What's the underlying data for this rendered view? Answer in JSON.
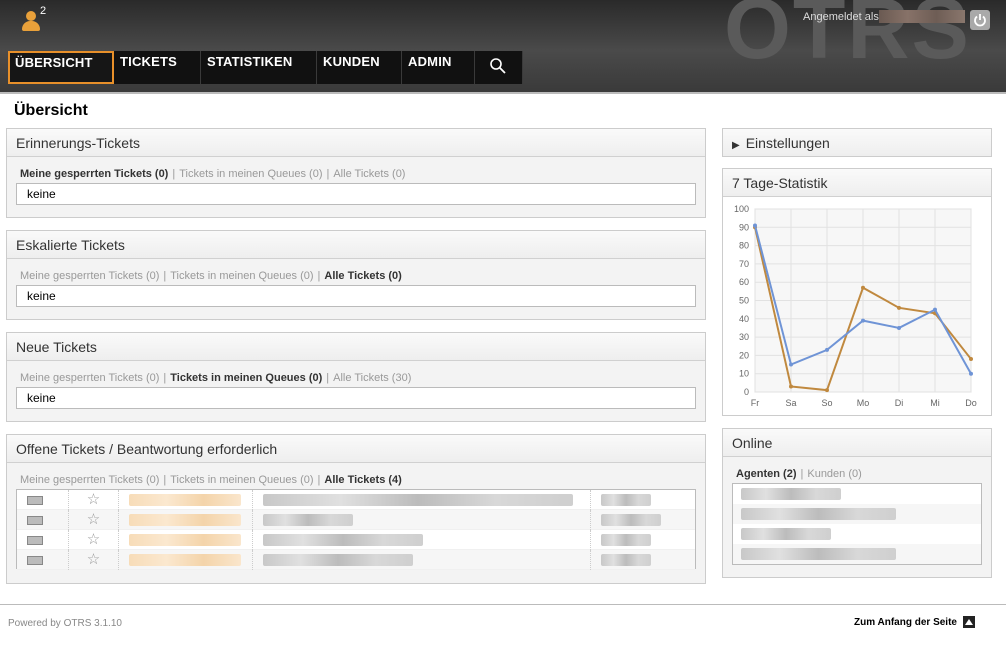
{
  "header": {
    "logo_text": "OTRS",
    "avatar_count": "2",
    "login_label": "Angemeldet als"
  },
  "nav": {
    "items": [
      {
        "label": "ÜBERSICHT",
        "active": true
      },
      {
        "label": "TICKETS",
        "active": false
      },
      {
        "label": "STATISTIKEN",
        "active": false
      },
      {
        "label": "KUNDEN",
        "active": false
      },
      {
        "label": "ADMIN",
        "active": false
      }
    ],
    "search_icon": "magnifier-icon"
  },
  "page": {
    "title": "Übersicht"
  },
  "widgets": {
    "reminder": {
      "title": "Erinnerungs-Tickets",
      "tabs": [
        "Meine gesperrten Tickets (0)",
        "Tickets in meinen Queues (0)",
        "Alle Tickets (0)"
      ],
      "selected": 0,
      "empty": "keine"
    },
    "escalated": {
      "title": "Eskalierte Tickets",
      "tabs": [
        "Meine gesperrten Tickets (0)",
        "Tickets in meinen Queues (0)",
        "Alle Tickets (0)"
      ],
      "selected": 2,
      "empty": "keine"
    },
    "new": {
      "title": "Neue Tickets",
      "tabs": [
        "Meine gesperrten Tickets (0)",
        "Tickets in meinen Queues (0)",
        "Alle Tickets (30)"
      ],
      "selected": 1,
      "empty": "keine"
    },
    "open": {
      "title": "Offene Tickets / Beantwortung erforderlich",
      "tabs": [
        "Meine gesperrten Tickets (0)",
        "Tickets in meinen Queues (0)",
        "Alle Tickets (4)"
      ],
      "selected": 2,
      "row_count": 4
    },
    "settings": {
      "title": "Einstellungen"
    },
    "stats": {
      "title": "7 Tage-Statistik"
    },
    "online": {
      "title": "Online",
      "tabs": [
        "Agenten (2)",
        "Kunden (0)"
      ],
      "selected": 0
    }
  },
  "colors": {
    "accent_orange": "#e8902a",
    "series_blue": "#6f94d6",
    "series_orange": "#c0893f"
  },
  "chart_data": {
    "type": "line",
    "categories": [
      "Fr",
      "Sa",
      "So",
      "Mo",
      "Di",
      "Mi",
      "Do"
    ],
    "series": [
      {
        "values": [
          90,
          3,
          1,
          57,
          46,
          43,
          18
        ],
        "color": "#c0893f"
      },
      {
        "values": [
          91,
          15,
          23,
          39,
          35,
          45,
          10
        ],
        "color": "#6f94d6"
      }
    ],
    "yticks": [
      0,
      10,
      20,
      30,
      40,
      50,
      60,
      70,
      80,
      90,
      100
    ],
    "ylim": [
      0,
      100
    ],
    "grid": true
  },
  "footer": {
    "powered": "Powered by OTRS 3.1.10",
    "to_top": "Zum Anfang der Seite"
  }
}
